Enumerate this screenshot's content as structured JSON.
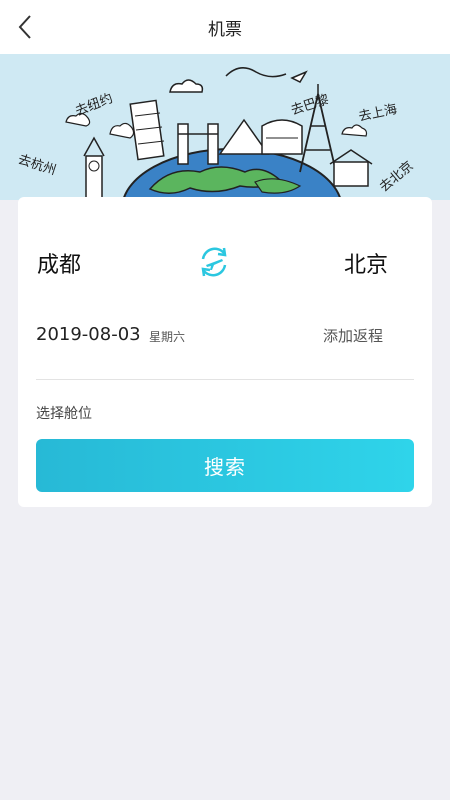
{
  "navbar": {
    "title": "机票",
    "back_icon": "chevron-left-icon"
  },
  "banner": {
    "labels": [
      "去纽约",
      "去杭州",
      "去巴黎",
      "去上海",
      "去北京"
    ]
  },
  "flight": {
    "from_city": "成都",
    "to_city": "北京",
    "swap_icon": "swap-plane-icon",
    "date": "2019-08-03",
    "weekday": "星期六",
    "add_return_label": "添加返程",
    "cabin_label": "选择舱位",
    "search_label": "搜索"
  },
  "colors": {
    "accent": "#2bc7e0",
    "banner_bg": "#cfe9f3",
    "page_bg": "#efeff4"
  }
}
